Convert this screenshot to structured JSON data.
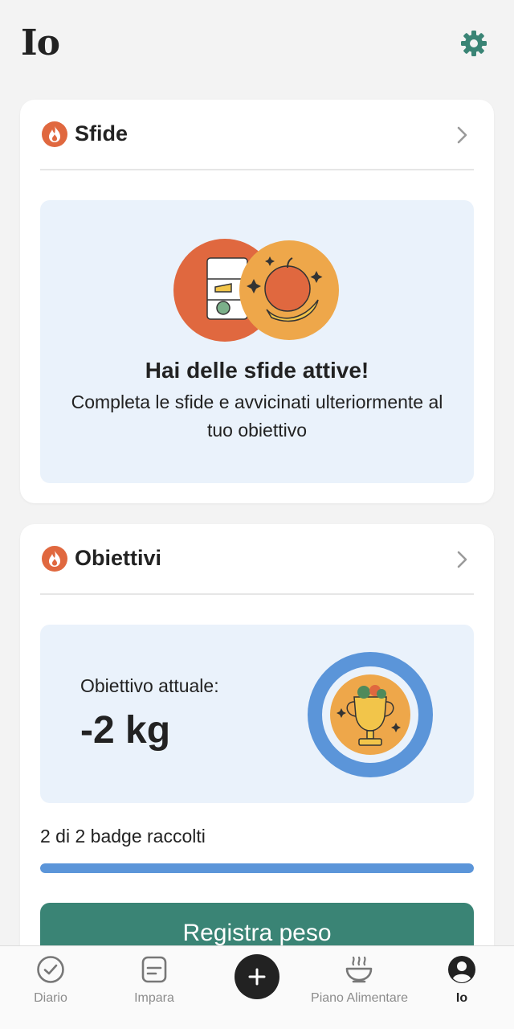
{
  "header": {
    "title": "Io",
    "settings_icon": "gear-icon",
    "accent_color": "#3a8475"
  },
  "challenges_card": {
    "title": "Sfide",
    "icon": "flame-icon",
    "panel_title": "Hai delle sfide attive!",
    "panel_subtitle": "Completa le sfide e avvicinati ulteriormente al tuo obiettivo"
  },
  "goals_card": {
    "title": "Obiettivi",
    "icon": "flame-icon",
    "goal_label": "Obiettivo attuale:",
    "goal_value": "-2 kg",
    "badges_text": "2 di 2 badge raccolti",
    "badges_progress": 1.0,
    "cta_label": "Registra peso"
  },
  "tabbar": {
    "tabs": [
      {
        "label": "Diario",
        "icon": "check-circle-icon",
        "active": false
      },
      {
        "label": "Impara",
        "icon": "document-icon",
        "active": false
      },
      {
        "label": "Piano Alimentare",
        "icon": "bowl-icon",
        "active": false
      },
      {
        "label": "Io",
        "icon": "profile-icon",
        "active": true
      }
    ],
    "add_icon": "plus-icon"
  },
  "colors": {
    "flame": "#e0683f",
    "panel_bg": "#eaf2fb",
    "progress": "#5b95d9",
    "cta": "#3a8475"
  }
}
